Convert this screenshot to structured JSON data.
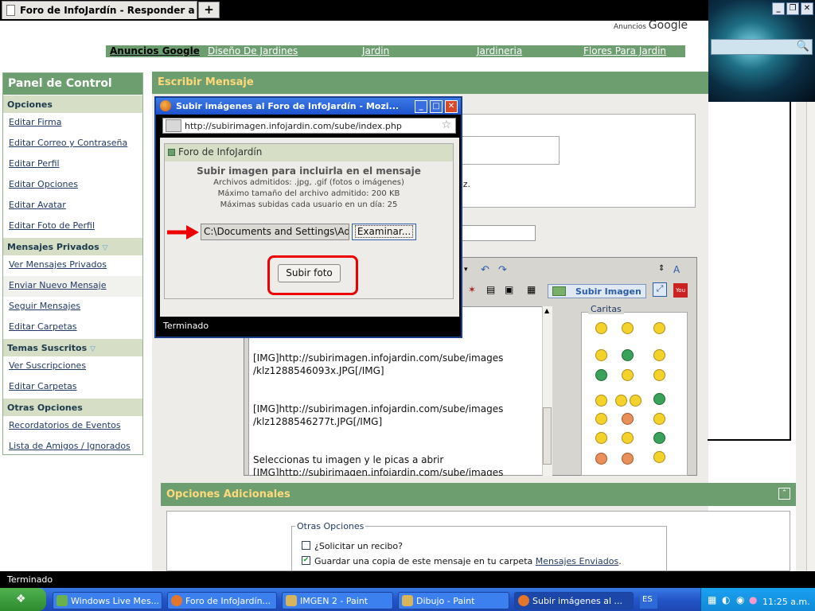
{
  "browser": {
    "tab_title": "Foro de InfoJardín - Responder a Me...",
    "newtab_label": "+",
    "status_text": "Terminado",
    "window_buttons": [
      "_",
      "❐",
      "✕"
    ]
  },
  "ads": {
    "header_prefix": "Anuncios",
    "header_brand": "Google",
    "links": [
      "Anuncios Google",
      "Diseño De Jardines",
      "Jardin",
      "Jardineria",
      "Flores Para Jardin"
    ]
  },
  "sidebar": {
    "title": "Panel de Control",
    "sections": [
      {
        "label": "Opciones",
        "items": [
          "Editar Firma",
          "Editar Correo y Contraseña",
          "Editar Perfil",
          "Editar Opciones",
          "Editar Avatar",
          "Editar Foto de Perfil"
        ]
      },
      {
        "label": "Mensajes Privados",
        "items": [
          "Ver Mensajes Privados",
          "Enviar Nuevo Mensaje",
          "Seguir Mensajes",
          "Editar Carpetas"
        ]
      },
      {
        "label": "Temas Suscritos",
        "items": [
          "Ver Suscripciones",
          "Editar Carpetas"
        ]
      },
      {
        "label": "Otras Opciones",
        "items": [
          "Recordatorios de Eventos",
          "Lista de Amigos / Ignorados"
        ]
      }
    ]
  },
  "main": {
    "header": "Escribir Mensaje",
    "to_fragment": "ez.",
    "subir_imagen_label": "Subir Imagen",
    "caritas_label": "Caritas",
    "textarea_lines": [
      "[IMG]http://subirimagen.infojardin.com/sube/images",
      "/klz1288546093x.JPG[/IMG]",
      "[IMG]http://subirimagen.infojardin.com/sube/images",
      "/klz1288546277t.JPG[/IMG]",
      "Seleccionas tu imagen y le picas a abrir",
      "[IMG]http://subirimagen.infojardin.com/sube/images"
    ]
  },
  "options": {
    "header": "Opciones Adicionales",
    "group_label": "Otras Opciones",
    "receipt_label": "¿Solicitar un recibo?",
    "save_copy_prefix": "Guardar una copia de este mensaje en tu carpeta",
    "save_copy_link": "Mensajes Enviados",
    "save_copy_suffix": "."
  },
  "popup": {
    "title": "Subir imágenes al Foro de InfoJardín - Mozi...",
    "url": "http://subirimagen.infojardin.com/sube/index.php",
    "box_header": "Foro de InfoJardín",
    "heading": "Subir imagen para incluirla en el mensaje",
    "info_lines": [
      "Archivos admitidos: .jpg, .gif (fotos o imágenes)",
      "Máximo tamaño del archivo admitido: 200 KB",
      "Máximas subidas cada usuario en un día: 25"
    ],
    "file_value": "C:\\Documents and Settings\\Ad",
    "browse_label": "Examinar...",
    "submit_label": "Subir foto",
    "status": "Terminado",
    "window_buttons": [
      "_",
      "□",
      "✕"
    ]
  },
  "taskbar": {
    "buttons": [
      "Windows Live Mes...",
      "Foro de InfoJardín...",
      "IMGEN 2 - Paint",
      "Dibujo - Paint",
      "Subir imágenes al ..."
    ],
    "language": "ES",
    "clock": "11:25 a.m."
  },
  "colors": {
    "accent_green": "#6d9e70",
    "header_text": "#ffd97a",
    "highlight_red": "#e00000"
  }
}
